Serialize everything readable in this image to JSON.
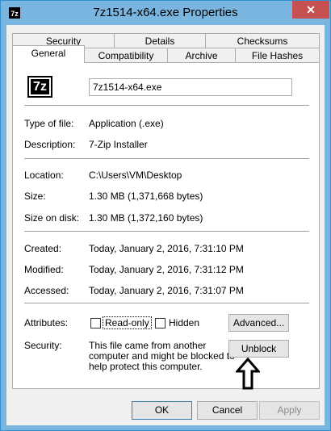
{
  "window": {
    "title": "7z1514-x64.exe Properties",
    "app_icon_text": "7z",
    "close_glyph": "✕"
  },
  "tabs_back": [
    {
      "label": "Security"
    },
    {
      "label": "Details"
    },
    {
      "label": "Checksums"
    }
  ],
  "tabs_front": [
    {
      "label": "General",
      "active": true
    },
    {
      "label": "Compatibility"
    },
    {
      "label": "Archive"
    },
    {
      "label": "File Hashes"
    }
  ],
  "general": {
    "icon_text": "7z",
    "file_name": "7z1514-x64.exe",
    "type_label": "Type of file:",
    "type_value": "Application (.exe)",
    "desc_label": "Description:",
    "desc_value": "7-Zip Installer",
    "location_label": "Location:",
    "location_value": "C:\\Users\\VM\\Desktop",
    "size_label": "Size:",
    "size_value": "1.30 MB (1,371,668 bytes)",
    "size_disk_label": "Size on disk:",
    "size_disk_value": "1.30 MB (1,372,160 bytes)",
    "created_label": "Created:",
    "created_value": "Today, January 2, 2016, 7:31:10 PM",
    "modified_label": "Modified:",
    "modified_value": "Today, January 2, 2016, 7:31:12 PM",
    "accessed_label": "Accessed:",
    "accessed_value": "Today, January 2, 2016, 7:31:07 PM",
    "attributes_label": "Attributes:",
    "readonly_label": "Read-only",
    "readonly_checked": false,
    "hidden_label": "Hidden",
    "hidden_checked": false,
    "advanced_label": "Advanced...",
    "security_label": "Security:",
    "security_text_1": "This file came from another",
    "security_text_2": "computer and might be blocked to",
    "security_text_3": "help protect this computer.",
    "unblock_label": "Unblock"
  },
  "footer": {
    "ok_label": "OK",
    "cancel_label": "Cancel",
    "apply_label": "Apply"
  },
  "colors": {
    "title_bar": "#7ab5e0",
    "close_button": "#c75050"
  }
}
